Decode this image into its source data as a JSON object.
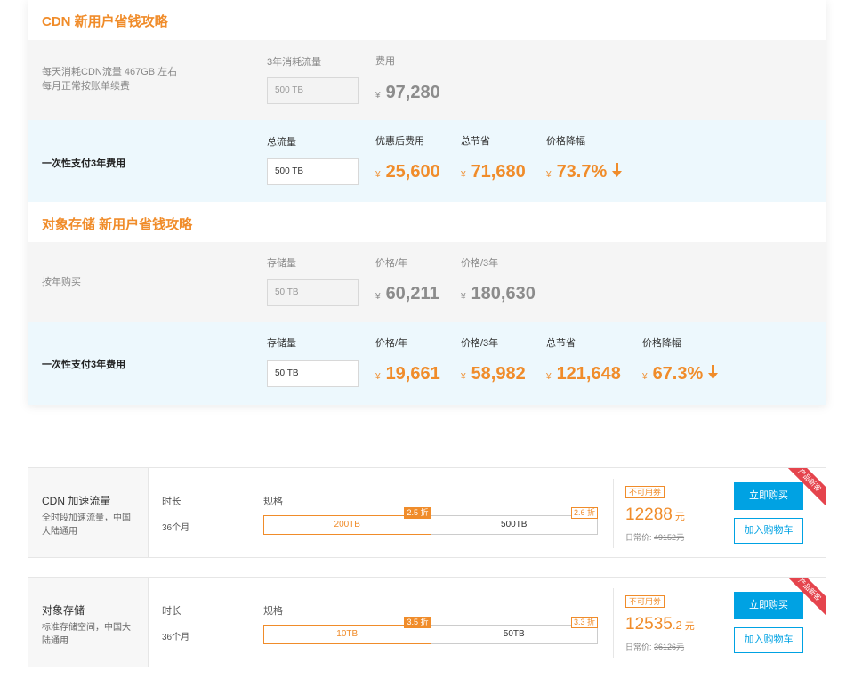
{
  "cdn_section": {
    "title": "CDN 新用户省钱攻略",
    "normal": {
      "desc_line1": "每天消耗CDN流量 467GB 左右",
      "desc_line2": "每月正常按账单续费",
      "col1_label": "3年消耗流量",
      "col1_input": "500 TB",
      "col2_label": "费用",
      "price": "97,280"
    },
    "onetime": {
      "title": "一次性支付3年费用",
      "col1_label": "总流量",
      "col1_input": "500 TB",
      "col2_label": "优惠后费用",
      "col2_value": "25,600",
      "col3_label": "总节省",
      "col3_value": "71,680",
      "col4_label": "价格降幅",
      "col4_value": "73.7%"
    }
  },
  "oss_section": {
    "title": "对象存储 新用户省钱攻略",
    "normal": {
      "desc": "按年购买",
      "col1_label": "存储量",
      "col1_input": "50 TB",
      "col2_label": "价格/年",
      "col2_value": "60,211",
      "col3_label": "价格/3年",
      "col3_value": "180,630"
    },
    "onetime": {
      "title": "一次性支付3年费用",
      "col1_label": "存储量",
      "col1_input": "50 TB",
      "col2_label": "价格/年",
      "col2_value": "19,661",
      "col3_label": "价格/3年",
      "col3_value": "58,982",
      "col4_label": "总节省",
      "col4_value": "121,648",
      "col5_label": "价格降幅",
      "col5_value": "67.3%"
    }
  },
  "currency": "¥",
  "products": [
    {
      "name": "CDN 加速流量",
      "desc": "全时段加速流量，中国大陆通用",
      "duration_label": "时长",
      "duration_value": "36个月",
      "spec_label": "规格",
      "options": [
        {
          "label": "200TB",
          "discount": "2.5 折",
          "selected": true
        },
        {
          "label": "500TB",
          "discount": "2.6 折",
          "selected": false
        }
      ],
      "coupon": "不可用券",
      "price_main": "12288",
      "price_decimal": "",
      "price_unit": "元",
      "orig_label": "日常价:",
      "orig_price": "49152元",
      "buy_label": "立即购买",
      "cart_label": "加入购物车",
      "ribbon": "产品新客"
    },
    {
      "name": "对象存储",
      "desc": "标准存储空间，中国大陆通用",
      "duration_label": "时长",
      "duration_value": "36个月",
      "spec_label": "规格",
      "options": [
        {
          "label": "10TB",
          "discount": "3.5 折",
          "selected": true
        },
        {
          "label": "50TB",
          "discount": "3.3 折",
          "selected": false
        }
      ],
      "coupon": "不可用券",
      "price_main": "12535",
      "price_decimal": ".2",
      "price_unit": "元",
      "orig_label": "日常价:",
      "orig_price": "36126元",
      "buy_label": "立即购买",
      "cart_label": "加入购物车",
      "ribbon": "产品新客"
    }
  ],
  "colors": {
    "accent": "#f08c2a",
    "primary": "#00a2e3",
    "ribbon": "#e5444d"
  },
  "icons": {
    "down_arrow": "arrow-down-icon"
  }
}
